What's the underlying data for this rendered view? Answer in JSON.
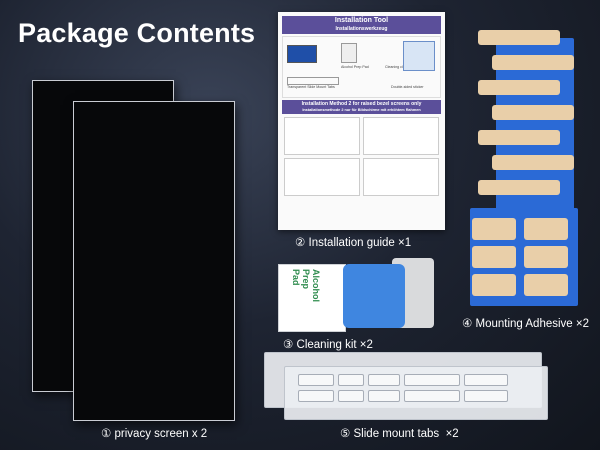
{
  "title": "Package Contents",
  "items": [
    {
      "num": "①",
      "label": "privacy screen x 2"
    },
    {
      "num": "②",
      "label": "Installation guide ×1"
    },
    {
      "num": "③",
      "label": "Cleaning kit ×2"
    },
    {
      "num": "④",
      "label": "Mounting Adhesive ×2"
    },
    {
      "num": "⑤",
      "label": "Slide mount tabs  ×2"
    }
  ],
  "guide": {
    "header_line1": "Installation Tool",
    "header_line2": "Installationswerkzeug",
    "label_tool": "Alcohol Prep Pad",
    "label_tool2": "Cleaning cloth",
    "label_tabs": "Transparent Slide Mount Tabs",
    "label_adhesive": "Double-sided sticker",
    "method_line1": "Installation Method 2 for raised bezel screens only",
    "method_line2": "Installationsmethode 2 nur für Bildschirme mit erhöhtem Rahmen"
  },
  "cleaning_kit": {
    "wipe_text1": "Alcohol",
    "wipe_text2": "Prep Pad"
  }
}
